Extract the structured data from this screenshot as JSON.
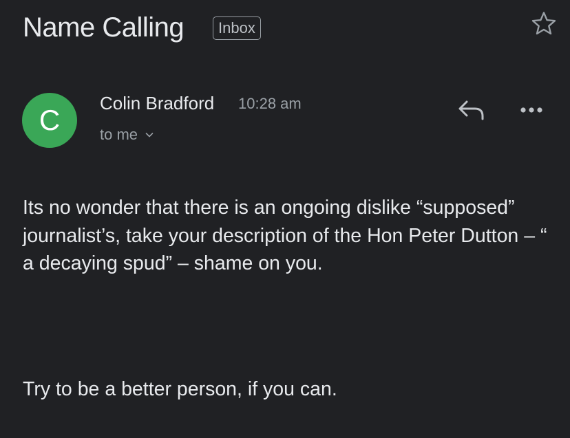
{
  "email": {
    "subject": "Name Calling",
    "label": "Inbox",
    "star_icon": "star-outline-icon",
    "sender": {
      "initial": "C",
      "name": "Colin Bradford",
      "time": "10:28 am",
      "recipient": "to me",
      "avatar_color": "#3aa757"
    },
    "actions": {
      "reply_icon": "reply-icon",
      "more_icon": "more-horizontal-icon"
    },
    "body": {
      "paragraph1": "Its no wonder that there is an ongoing dislike “supposed” journalist’s, take your description of the Hon Peter Dutton – “ a decaying spud” – shame on you.",
      "paragraph2": "Try to be a better person, if you can."
    }
  },
  "theme": {
    "background": "#202124",
    "text_primary": "#e8eaed",
    "text_secondary": "#9aa0a6"
  }
}
